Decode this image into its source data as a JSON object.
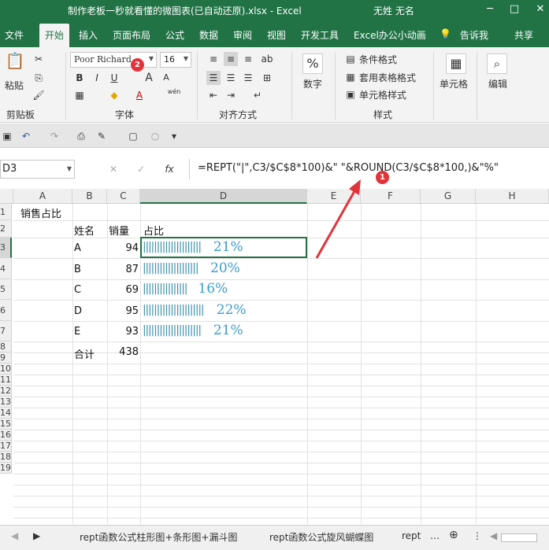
{
  "window": {
    "title": "制作老板一秒就看懂的微图表(已自动还原).xlsx  -  Excel",
    "user": "无姓 无名",
    "controls": [
      "─",
      "□",
      "✕"
    ]
  },
  "tabs": [
    "文件",
    "开始",
    "插入",
    "页面布局",
    "公式",
    "数据",
    "审阅",
    "视图",
    "开发工具",
    "Excel办公小动画",
    "告诉我",
    "共享"
  ],
  "ribbon": {
    "clipboard": {
      "paste": "粘贴",
      "label": "剪贴板"
    },
    "font": {
      "name": "Poor Richard",
      "size": "16",
      "label": "字体",
      "bold": "B",
      "italic": "I",
      "underline": "U",
      "grow": "A",
      "shrink": "A",
      "wen": "wén"
    },
    "align": {
      "label": "对齐方式"
    },
    "number": {
      "symbol": "%",
      "label": "数字"
    },
    "styles": {
      "cond": "条件格式",
      "table": "套用表格格式",
      "cell": "单元格样式",
      "label": "样式"
    },
    "cells": {
      "label": "单元格"
    },
    "edit": {
      "label": "编辑"
    },
    "badges": [
      "2",
      "1"
    ]
  },
  "formula_bar": {
    "name_box": "D3",
    "cancel": "✕",
    "enter": "✓",
    "fx": "fx",
    "formula": "=REPT(\"|\",C3/$C$8*100)&\"  \"&ROUND(C3/$C$8*100,)&\"%\""
  },
  "columns": [
    "A",
    "B",
    "C",
    "D",
    "E",
    "F",
    "G",
    "H"
  ],
  "rows": [
    "1",
    "2",
    "3",
    "4",
    "5",
    "6",
    "7",
    "8",
    "9",
    "10",
    "11",
    "12",
    "13",
    "14",
    "15",
    "16",
    "17",
    "18",
    "19"
  ],
  "sheet": {
    "title": "销售占比",
    "headers": {
      "name": "姓名",
      "sales": "销量",
      "share": "占比"
    },
    "records": [
      {
        "name": "A",
        "sales": "94",
        "pct": "21%",
        "share": 0.21
      },
      {
        "name": "B",
        "sales": "87",
        "pct": "20%",
        "share": 0.2
      },
      {
        "name": "C",
        "sales": "69",
        "pct": "16%",
        "share": 0.16
      },
      {
        "name": "D",
        "sales": "95",
        "pct": "22%",
        "share": 0.22
      },
      {
        "name": "E",
        "sales": "93",
        "pct": "21%",
        "share": 0.21
      }
    ],
    "total_label": "合计",
    "total": "438"
  },
  "sheet_tabs": [
    "rept函数公式柱形图+条形图+漏斗图",
    "rept函数公式旋风蝴蝶图",
    "rept"
  ],
  "colors": {
    "excel_green": "#217346",
    "bar": "#3b8fae",
    "badge": "#e2333a"
  }
}
